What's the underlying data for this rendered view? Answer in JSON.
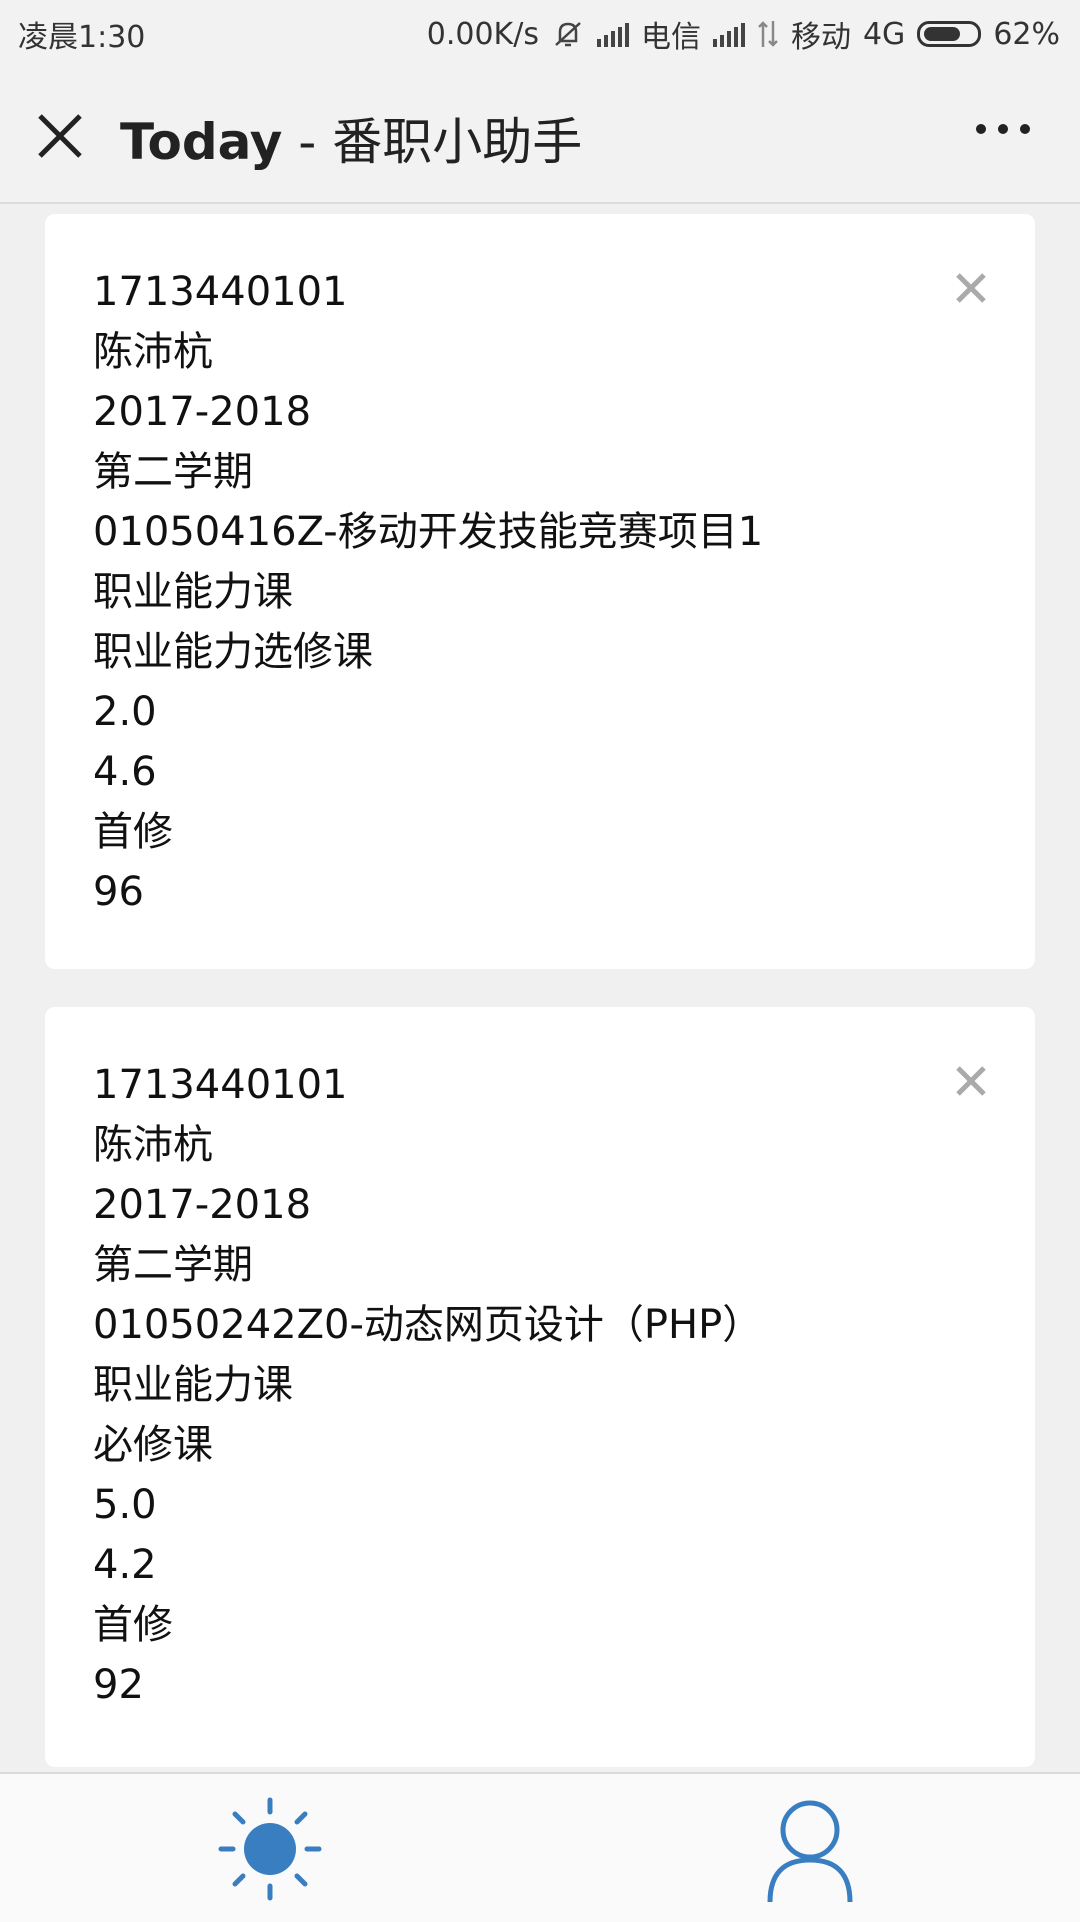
{
  "status_bar": {
    "time": "凌晨1:30",
    "speed": "0.00K/s",
    "carrier1": "电信",
    "carrier2": "移动",
    "network": "4G",
    "battery": "62%"
  },
  "nav": {
    "title_app": "Today",
    "title_sep": " - ",
    "title_name": "番职小助手"
  },
  "cards": [
    {
      "lines": [
        "1713440101",
        "陈沛杭",
        "2017-2018",
        "第二学期",
        "01050416Z-移动开发技能竞赛项目1",
        "职业能力课",
        "职业能力选修课",
        "2.0",
        "4.6",
        "首修",
        "96"
      ]
    },
    {
      "lines": [
        "1713440101",
        "陈沛杭",
        "2017-2018",
        "第二学期",
        "01050242Z0-动态网页设计（PHP）",
        "职业能力课",
        "必修课",
        "5.0",
        "4.2",
        "首修",
        "92"
      ]
    }
  ],
  "tabs": [
    {
      "icon": "sun-icon",
      "color": "#3a7ec2"
    },
    {
      "icon": "user-icon",
      "color": "#3a7ec2"
    }
  ]
}
